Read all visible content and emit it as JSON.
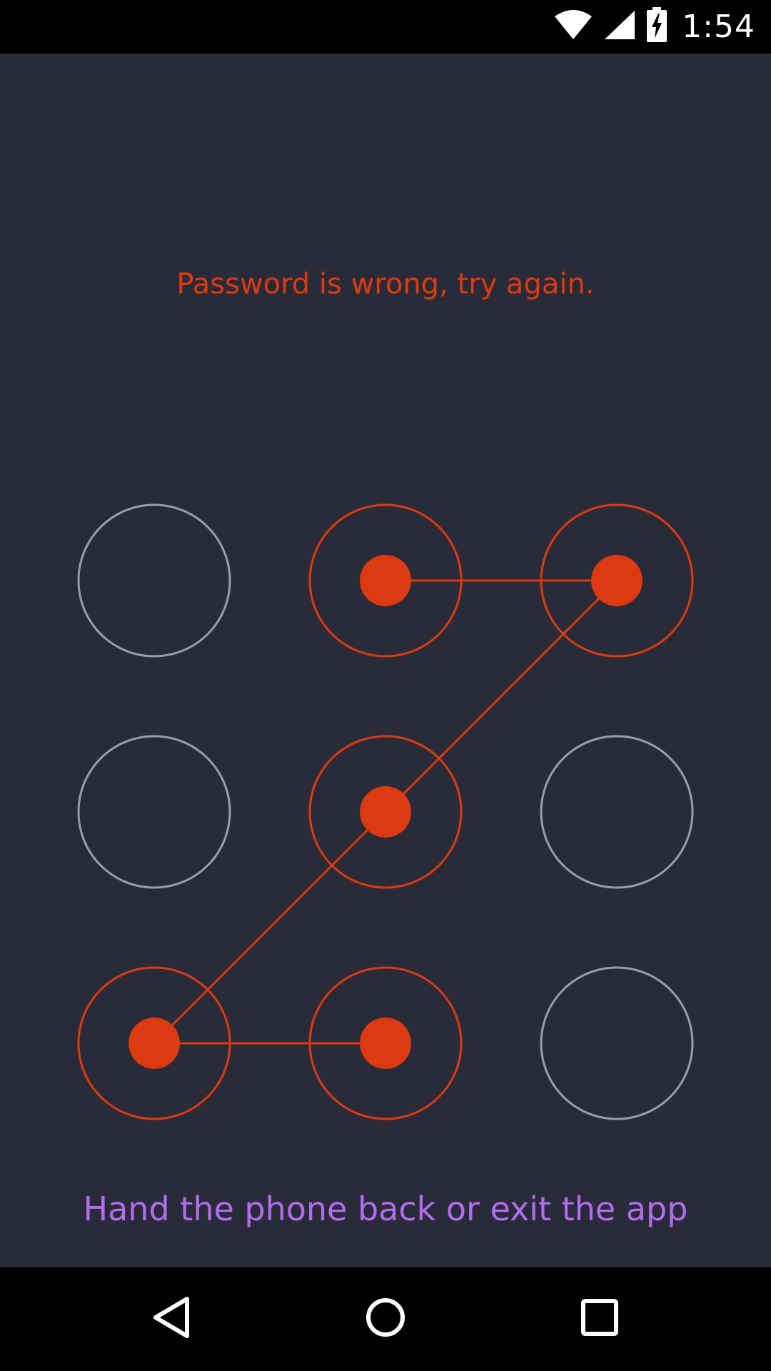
{
  "status_bar": {
    "time": "1:54",
    "icons": [
      "wifi-icon",
      "cell-signal-icon",
      "battery-charging-icon"
    ]
  },
  "lock_screen": {
    "error_message": "Password is wrong, try again.",
    "hint": "Hand the phone back or exit the app",
    "pattern": {
      "grid_size": 3,
      "selected_nodes": [
        2,
        3,
        5,
        7,
        8
      ],
      "path_order": [
        2,
        3,
        5,
        7,
        8
      ]
    }
  },
  "nav_bar": {
    "buttons": [
      "back-icon",
      "home-icon",
      "recents-icon"
    ]
  },
  "colors": {
    "background": "#2a2b38",
    "bars": "#000000",
    "error": "#dc3a10",
    "active": "#dc3a10",
    "inactive_ring": "#9a9bb0",
    "hint": "#b36cf0"
  }
}
